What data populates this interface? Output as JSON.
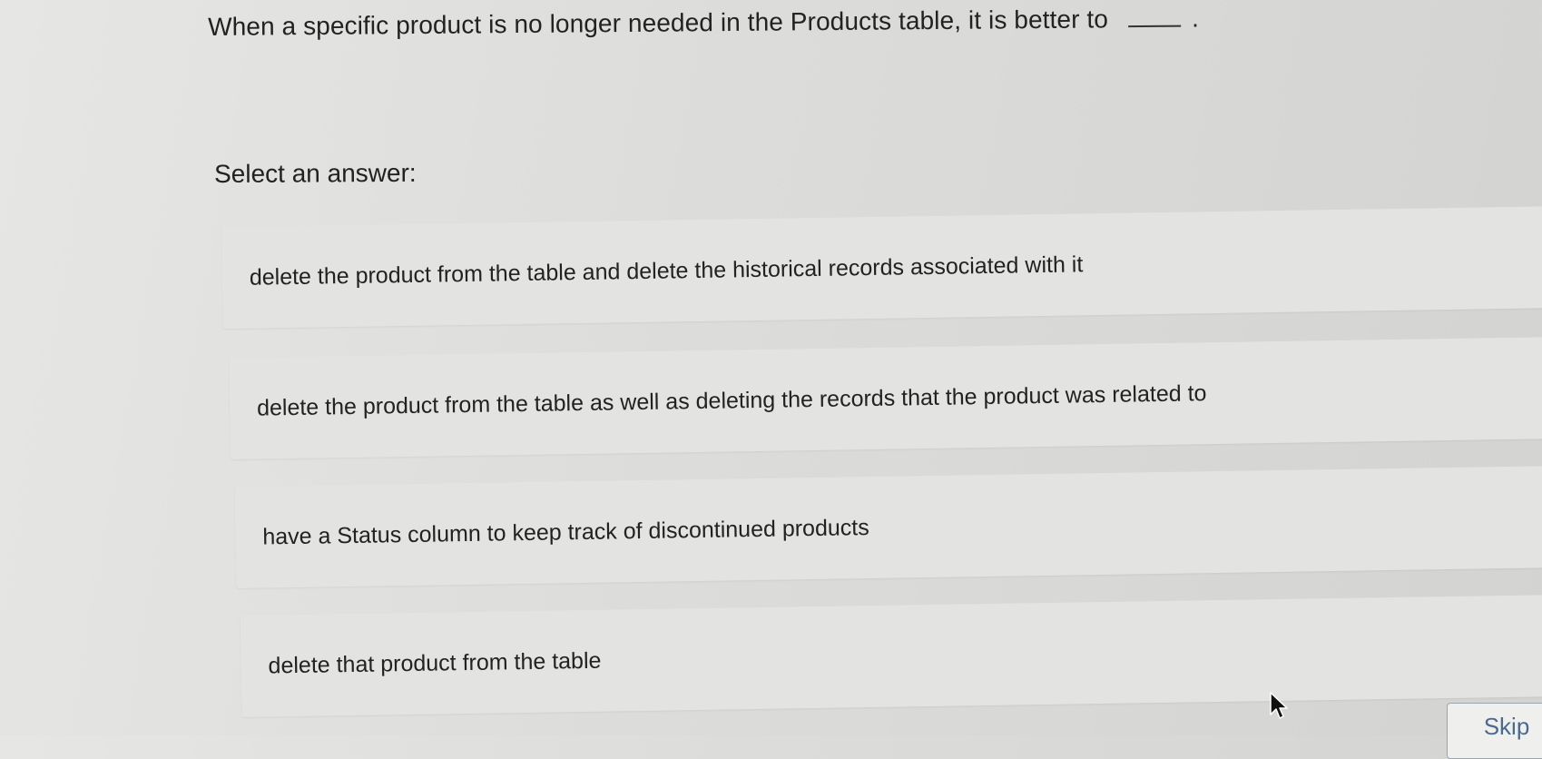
{
  "question": {
    "text": "When a specific product is no longer needed in the Products table, it is better to",
    "end": "."
  },
  "prompt": "Select an answer:",
  "options": [
    {
      "label": "delete the product from the table and delete the historical records associated with it"
    },
    {
      "label": "delete the product from the table as well as deleting the records that the product was related to"
    },
    {
      "label": "have a Status column to keep track of discontinued products"
    },
    {
      "label": "delete that product from the table"
    }
  ],
  "actions": {
    "skip_label": "Skip"
  },
  "icons": {
    "cursor": "mouse-pointer-icon"
  }
}
